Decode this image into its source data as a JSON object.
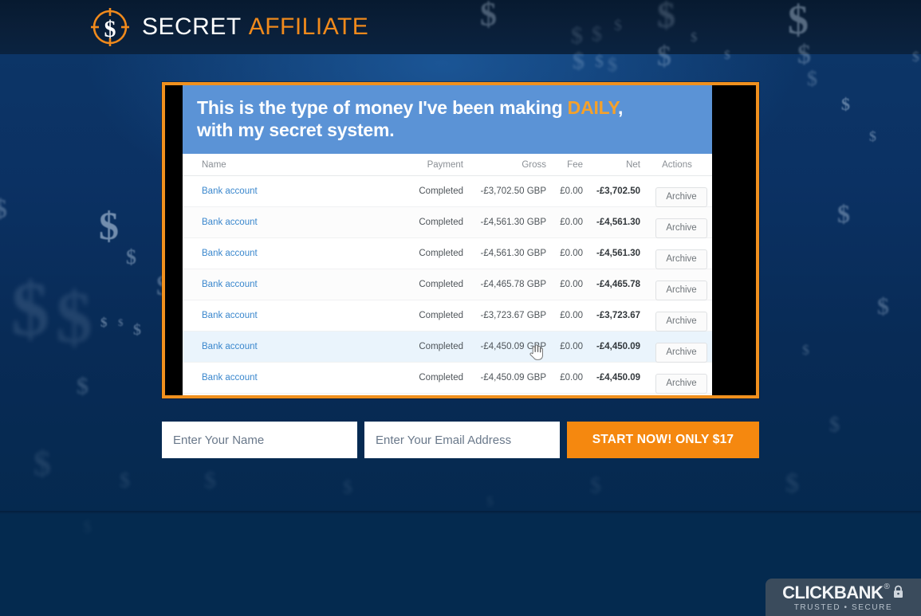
{
  "header": {
    "logo_icon": "dollar-target-icon",
    "brand_first": "SECRET",
    "brand_second": "AFFILIATE",
    "brand_first_color": "#ffffff",
    "brand_second_color": "#f08a1c"
  },
  "hero": {
    "banner_line1_a": "This is the type of money I've been making ",
    "banner_highlight": "DAILY",
    "banner_line1_b": ",",
    "banner_line2": "with my secret system.",
    "banner_bg": "#5b93d6",
    "highlight_color": "#f5a12a",
    "frame_border_color": "#f0901e"
  },
  "table": {
    "columns": [
      "Name",
      "Payment",
      "Gross",
      "Fee",
      "Net",
      "Actions"
    ],
    "rows": [
      {
        "name": "Bank account",
        "payment": "Completed",
        "gross": "-£3,702.50 GBP",
        "fee": "£0.00",
        "net": "-£3,702.50",
        "action": "Archive"
      },
      {
        "name": "Bank account",
        "payment": "Completed",
        "gross": "-£4,561.30 GBP",
        "fee": "£0.00",
        "net": "-£4,561.30",
        "action": "Archive"
      },
      {
        "name": "Bank account",
        "payment": "Completed",
        "gross": "-£4,561.30 GBP",
        "fee": "£0.00",
        "net": "-£4,561.30",
        "action": "Archive"
      },
      {
        "name": "Bank account",
        "payment": "Completed",
        "gross": "-£4,465.78 GBP",
        "fee": "£0.00",
        "net": "-£4,465.78",
        "action": "Archive"
      },
      {
        "name": "Bank account",
        "payment": "Completed",
        "gross": "-£3,723.67 GBP",
        "fee": "£0.00",
        "net": "-£3,723.67",
        "action": "Archive"
      },
      {
        "name": "Bank account",
        "payment": "Completed",
        "gross": "-£4,450.09 GBP",
        "fee": "£0.00",
        "net": "-£4,450.09",
        "action": "Archive"
      },
      {
        "name": "Bank account",
        "payment": "Completed",
        "gross": "-£4,450.09 GBP",
        "fee": "£0.00",
        "net": "-£4,450.09",
        "action": "Archive"
      }
    ],
    "link_color": "#3a87cd",
    "hover_row_index": 5
  },
  "form": {
    "name_placeholder": "Enter Your Name",
    "name_value": "",
    "email_placeholder": "Enter Your Email Address",
    "email_value": "",
    "cta_label": "START NOW! ONLY $17",
    "cta_color": "#f5880f"
  },
  "badge": {
    "brand_bold": "CLICKBANK",
    "brand_light": "",
    "registered": "®",
    "lock_icon": "lock-icon",
    "tagline": "TRUSTED • SECURE",
    "bg": "#3a4b5c"
  },
  "background": {
    "motif": "dollar-sign-pattern",
    "header_color": "#0a1f39",
    "body_color": "#0b3162",
    "footer_color": "#042a4f"
  }
}
